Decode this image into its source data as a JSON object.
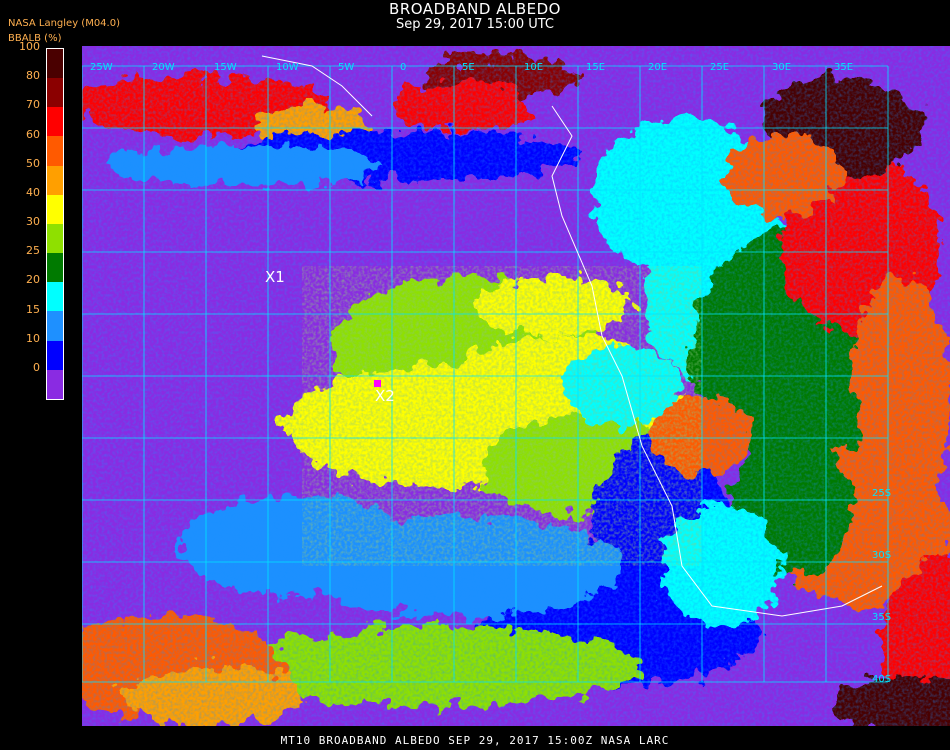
{
  "header": {
    "title": "BROADBAND ALBEDO",
    "datetime": "Sep 29, 2017 15:00 UTC",
    "source": "NASA Langley (M04.0)"
  },
  "colorbar": {
    "title": "BBALB (%)",
    "ticks": [
      "100",
      "80",
      "70",
      "60",
      "50",
      "40",
      "30",
      "25",
      "20",
      "15",
      "10",
      "0"
    ],
    "colors": [
      "#4a0000",
      "#8b0000",
      "#ff0000",
      "#ff5a00",
      "#ff9f00",
      "#ffff00",
      "#8fe000",
      "#007a00",
      "#00ffff",
      "#1e90ff",
      "#0000ff",
      "#8a2be2"
    ]
  },
  "map": {
    "grid_color": "#00e5ff",
    "lon_labels": [
      "25W",
      "20W",
      "15W",
      "10W",
      "5W",
      "0",
      "5E",
      "10E",
      "15E",
      "20E",
      "25E",
      "30E",
      "35E"
    ],
    "lat_labels": [
      "25S",
      "30S",
      "35S",
      "40S"
    ],
    "markers": [
      {
        "label": "X1"
      },
      {
        "label": "X2"
      }
    ]
  },
  "footer": "MT10  BROADBAND ALBEDO   SEP 29, 2017 15:00Z   NASA LARC"
}
